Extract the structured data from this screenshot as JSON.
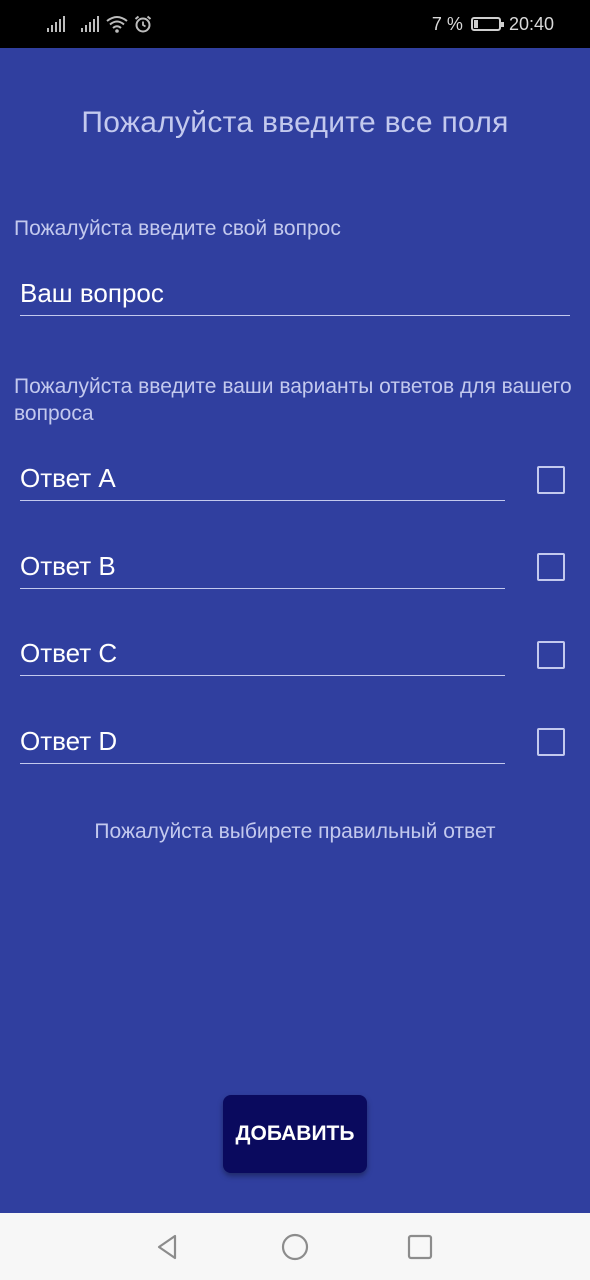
{
  "status_bar": {
    "battery_percent": "7 %",
    "time": "20:40",
    "icons": [
      "signal-icon",
      "signal-icon",
      "wifi-icon",
      "alarm-icon",
      "battery-charging-icon"
    ]
  },
  "form": {
    "title": "Пожалуйста введите все поля",
    "question_label": "Пожалуйста введите свой вопрос",
    "question_placeholder": "Ваш вопрос",
    "answers_label": "Пожалуйста введите ваши варианты ответов для вашего вопроса",
    "answers": [
      {
        "placeholder": "Ответ A",
        "checked": false
      },
      {
        "placeholder": "Ответ B",
        "checked": false
      },
      {
        "placeholder": "Ответ C",
        "checked": false
      },
      {
        "placeholder": "Ответ D",
        "checked": false
      }
    ],
    "hint": "Пожалуйста выбирете правильный ответ",
    "submit_label": "ДОБАВИТЬ"
  },
  "navigation": {
    "icons": [
      "back-icon",
      "home-icon",
      "recent-apps-icon"
    ]
  },
  "colors": {
    "background": "#303F9F",
    "status_bar": "#000000",
    "button": "#0a0a5e",
    "label_text": "#c3c9ee",
    "nav_bar": "#f7f7f7"
  }
}
